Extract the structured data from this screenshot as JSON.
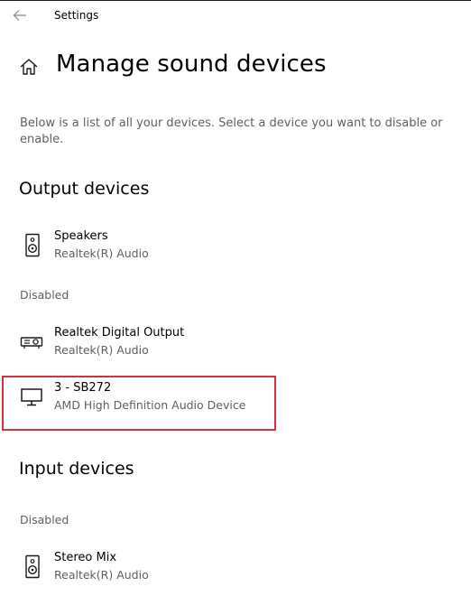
{
  "window": {
    "title": "Settings"
  },
  "page": {
    "title": "Manage sound devices",
    "description": "Below is a list of all your devices. Select a device you want to disable or enable."
  },
  "output": {
    "header": "Output devices",
    "devices": [
      {
        "name": "Speakers",
        "driver": "Realtek(R) Audio",
        "icon": "speaker-icon"
      }
    ],
    "disabled_label": "Disabled",
    "disabled_devices": [
      {
        "name": "Realtek Digital Output",
        "driver": "Realtek(R) Audio",
        "icon": "digital-output-icon"
      },
      {
        "name": "3 - SB272",
        "driver": "AMD High Definition Audio Device",
        "icon": "monitor-icon",
        "highlighted": true
      }
    ]
  },
  "input": {
    "header": "Input devices",
    "disabled_label": "Disabled",
    "disabled_devices": [
      {
        "name": "Stereo Mix",
        "driver": "Realtek(R) Audio",
        "icon": "speaker-icon"
      }
    ]
  },
  "colors": {
    "highlight_border": "#d1343b",
    "secondary_text": "#5f5f5f"
  }
}
